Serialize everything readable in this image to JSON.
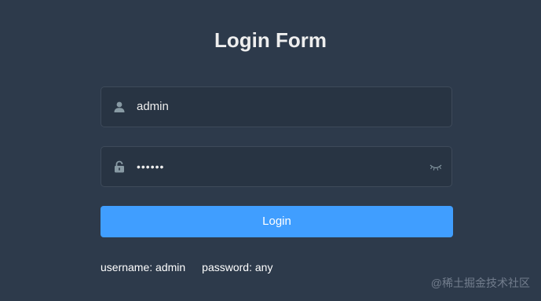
{
  "form": {
    "title": "Login Form",
    "username": {
      "icon": "user-icon",
      "value": "admin"
    },
    "password": {
      "icon": "lock-icon",
      "value": "••••••",
      "toggle_icon": "eye-closed-icon"
    },
    "login_label": "Login"
  },
  "tips": {
    "username": "username: admin",
    "password": "password: any"
  },
  "watermark": "@稀土掘金技术社区",
  "colors": {
    "background": "#2d3a4b",
    "field": "#283443",
    "accent": "#409eff"
  }
}
